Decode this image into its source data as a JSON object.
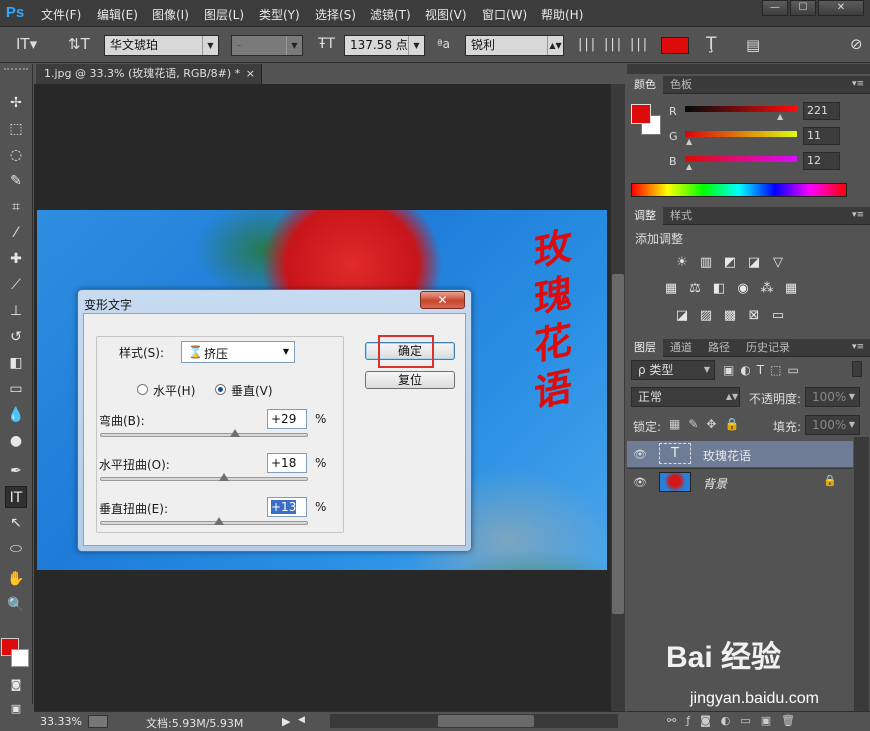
{
  "app": {
    "logo": "Ps"
  },
  "menubar": {
    "items": [
      "文件(F)",
      "编辑(E)",
      "图像(I)",
      "图层(L)",
      "类型(Y)",
      "选择(S)",
      "滤镜(T)",
      "视图(V)",
      "窗口(W)",
      "帮助(H)"
    ],
    "win_min": "—",
    "win_max": "☐",
    "win_close": "✕"
  },
  "options": {
    "font_family": "华文琥珀",
    "font_style": "-",
    "font_size": "137.58 点",
    "aa_label": "ªa",
    "anti_alias": "锐利",
    "text_color": "#dd0b0c"
  },
  "document": {
    "tab_title": "1.jpg @ 33.3% (玫瑰花语, RGB/8#) *",
    "tab_close": "×",
    "text_layer_content": [
      "玫",
      "瑰",
      "花",
      "语"
    ]
  },
  "status": {
    "zoom": "33.33%",
    "doc_size": "文档:5.93M/5.93M"
  },
  "dialog": {
    "title": "变形文字",
    "close": "✕",
    "style_label": "样式(S):",
    "style_value": "挤压",
    "horizontal_label": "水平(H)",
    "vertical_label": "垂直(V)",
    "orientation": "vertical",
    "bend_label": "弯曲(B):",
    "bend_value": "+29",
    "hdist_label": "水平扭曲(O):",
    "hdist_value": "+18",
    "vdist_label": "垂直扭曲(E):",
    "vdist_value": "+13",
    "percent": "%",
    "ok_label": "确定",
    "reset_label": "复位",
    "bend_level": 0.645,
    "hdist_level": 0.59,
    "vdist_level": 0.565
  },
  "color_panel": {
    "tabs": [
      "颜色",
      "色板"
    ],
    "r_label": "R",
    "r_value": "221",
    "g_label": "G",
    "g_value": "11",
    "b_label": "B",
    "b_value": "12",
    "foreground": "#dd0b0c",
    "background": "#ffffff"
  },
  "adjust_panel": {
    "tabs": [
      "调整",
      "样式"
    ],
    "add_label": "添加调整"
  },
  "layers_panel": {
    "tabs": [
      "图层",
      "通道",
      "路径",
      "历史记录"
    ],
    "filter_label": "ρ 类型",
    "blend_mode": "正常",
    "opacity_label": "不透明度:",
    "opacity_value": "100%",
    "lock_label": "锁定:",
    "fill_label": "填充:",
    "fill_value": "100%",
    "layers": [
      {
        "name": "玫瑰花语",
        "type": "text",
        "selected": true
      },
      {
        "name": "背景",
        "type": "image",
        "locked": true
      }
    ]
  },
  "watermark": {
    "text": "Bai 经验",
    "url": "jingyan.baidu.com"
  }
}
